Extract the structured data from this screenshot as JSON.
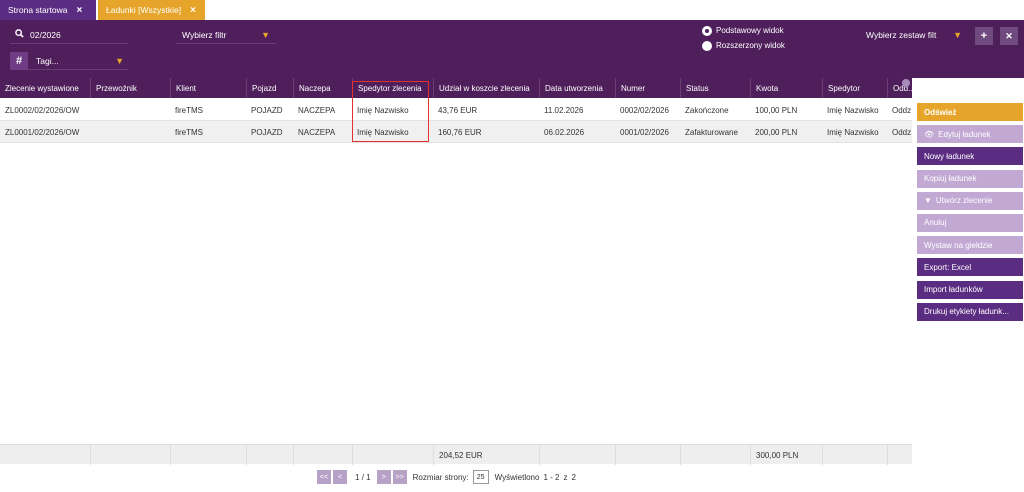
{
  "tabs": [
    {
      "label": "Strona startowa"
    },
    {
      "label": "Ładunki [Wszystkie]"
    }
  ],
  "header": {
    "search_value": "02/2026",
    "filter_select": "Wybierz filtr",
    "tags_placeholder": "Tagi...",
    "view_basic": "Podstawowy widok",
    "view_extended": "Rozszerzony widok",
    "filterset_select": "Wybierz zestaw filt",
    "icons": {
      "search": "search-icon",
      "hash": "hash-icon",
      "add": "plus-icon",
      "clear": "close-icon"
    }
  },
  "table": {
    "columns": [
      "Zlecenie wystawione",
      "Przewoźnik",
      "Klient",
      "Pojazd",
      "Naczepa",
      "Spedytor zlecenia",
      "Udział w koszcie zlecenia",
      "Data utworzenia",
      "Numer",
      "Status",
      "Kwota",
      "Spedytor",
      "Odd..."
    ],
    "rows": [
      [
        "ZL0002/02/2026/OW",
        "",
        "fireTMS",
        "POJAZD",
        "NACZEPA",
        "Imię Nazwisko",
        "43,76 EUR",
        "11.02.2026",
        "0002/02/2026",
        "Zakończone",
        "100,00 PLN",
        "Imię Nazwisko",
        "Oddz"
      ],
      [
        "ZL0001/02/2026/OW",
        "",
        "fireTMS",
        "POJAZD",
        "NACZEPA",
        "Imię Nazwisko",
        "160,76 EUR",
        "06.02.2026",
        "0001/02/2026",
        "Zafakturowane",
        "200,00 PLN",
        "Imię Nazwisko",
        "Oddz"
      ]
    ],
    "totals": {
      "cost_share": "204,52 EUR",
      "amount": "300,00 PLN"
    }
  },
  "pager": {
    "first": "<<",
    "prev": "<",
    "page_current": "1",
    "page_sep": "/",
    "page_total": "1",
    "next": ">",
    "last": ">>",
    "page_size_label": "Rozmiar strony:",
    "page_size": "25",
    "shown_label": "Wyświetlono",
    "shown_range": "1 - 2",
    "shown_of": "z",
    "shown_total": "2"
  },
  "sidebar": {
    "refresh": "Odśwież",
    "edit": "Edytuj ładunek",
    "new": "Nowy ładunek",
    "copy": "Kopiuj ładunek",
    "create_order": "Utwórz zlecenie",
    "cancel": "Anuluj",
    "publish": "Wystaw na giełdzie",
    "export": "Export: Excel",
    "import": "Import ładunków",
    "print": "Drukuj etykiety ładunk..."
  },
  "colors": {
    "primary": "#4f1f5b",
    "accent": "#e6a52a",
    "button_dark": "#5b2d82",
    "button_light": "#c2a9d4",
    "highlight": "#e03030"
  }
}
